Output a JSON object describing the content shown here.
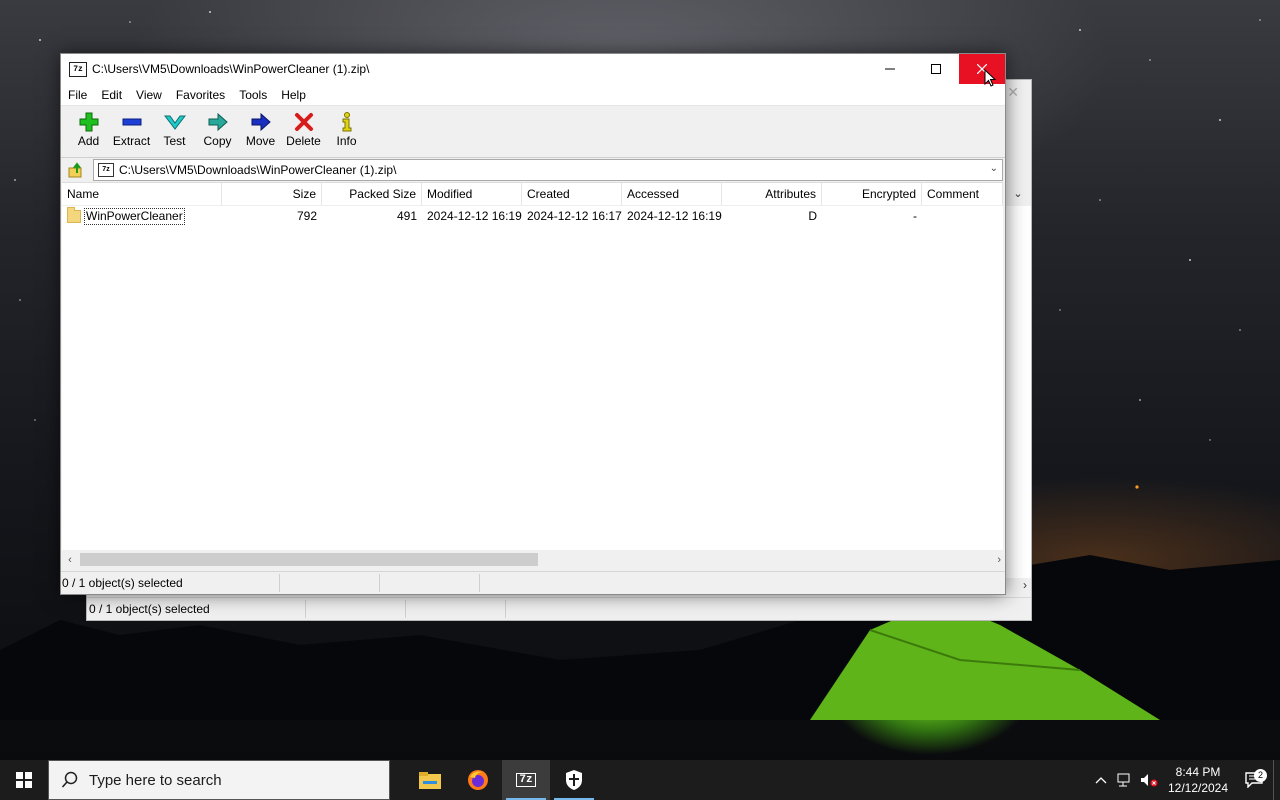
{
  "window": {
    "title": "C:\\Users\\VM5\\Downloads\\WinPowerCleaner (1).zip\\",
    "app_icon_text": "7z",
    "menu": [
      "File",
      "Edit",
      "View",
      "Favorites",
      "Tools",
      "Help"
    ],
    "toolbar": [
      {
        "label": "Add",
        "icon": "add-icon"
      },
      {
        "label": "Extract",
        "icon": "extract-icon"
      },
      {
        "label": "Test",
        "icon": "test-icon"
      },
      {
        "label": "Copy",
        "icon": "copy-icon"
      },
      {
        "label": "Move",
        "icon": "move-icon"
      },
      {
        "label": "Delete",
        "icon": "delete-icon"
      },
      {
        "label": "Info",
        "icon": "info-icon"
      }
    ],
    "address": "C:\\Users\\VM5\\Downloads\\WinPowerCleaner (1).zip\\",
    "columns": [
      "Name",
      "Size",
      "Packed Size",
      "Modified",
      "Created",
      "Accessed",
      "Attributes",
      "Encrypted",
      "Comment"
    ],
    "rows": [
      {
        "name": "WinPowerCleaner",
        "size": "792",
        "packed": "491",
        "modified": "2024-12-12 16:19",
        "created": "2024-12-12 16:17",
        "accessed": "2024-12-12 16:19",
        "attributes": "D",
        "encrypted": "-",
        "comment": ""
      }
    ],
    "status": "0 / 1 object(s) selected",
    "close_color": "#e81123"
  },
  "background_window": {
    "status": "0 / 1 object(s) selected"
  },
  "taskbar": {
    "search_placeholder": "Type here to search",
    "time": "8:44 PM",
    "date": "12/12/2024",
    "notification_count": "2",
    "apps": [
      "file-explorer-icon",
      "firefox-icon",
      "7zip-icon",
      "security-icon"
    ],
    "active_app_text": "7z"
  }
}
